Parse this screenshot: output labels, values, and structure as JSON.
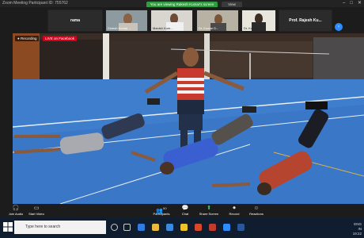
{
  "window": {
    "title": "Zoom Meeting Participant ID: 755762",
    "controls": [
      "–",
      "□",
      "✕"
    ]
  },
  "banner": {
    "sharing_text": "You are viewing Rakesh Kumar's screen",
    "view_options": "View Options ▾"
  },
  "thumbnails": [
    {
      "name": "rama",
      "type": "name-only"
    },
    {
      "name": "Dinesh Kumar ...",
      "type": "video"
    },
    {
      "name": "Manish Kum...",
      "type": "video"
    },
    {
      "name": "Dr. Kumar D...",
      "type": "video"
    },
    {
      "name": "Dr. Kumar...",
      "type": "video"
    },
    {
      "name": "Prof. Rajesh Ku...",
      "type": "name-only"
    }
  ],
  "video": {
    "recording_label": "● Recording",
    "live_label": "LIVE on Facebook"
  },
  "toolbar": {
    "items": [
      {
        "label": "Join Audio",
        "icon": "headphones-icon"
      },
      {
        "label": "Start Video",
        "icon": "camera-icon"
      },
      {
        "label": "Participants",
        "icon": "participants-icon",
        "count": "60"
      },
      {
        "label": "Chat",
        "icon": "chat-icon"
      },
      {
        "label": "Share Screen",
        "icon": "share-screen-icon"
      },
      {
        "label": "Record",
        "icon": "record-icon"
      },
      {
        "label": "Reactions",
        "icon": "reactions-icon"
      }
    ]
  },
  "taskbar": {
    "search_placeholder": "Type here to search",
    "tray_lang": "ENG\nIN",
    "tray_time": "19:22"
  }
}
